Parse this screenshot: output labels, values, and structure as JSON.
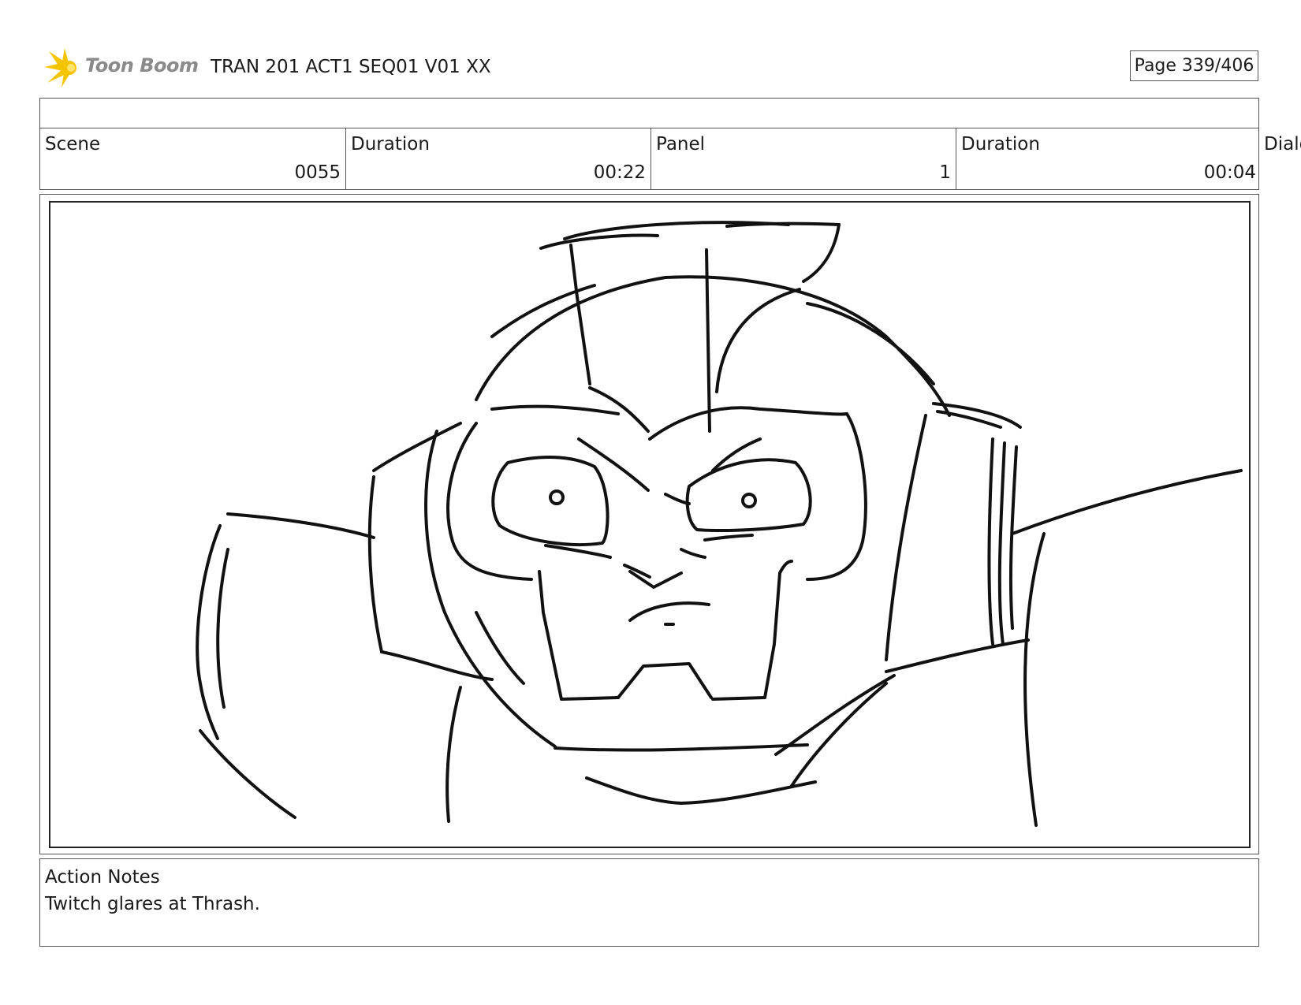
{
  "header": {
    "logo_text": "Toon Boom",
    "project_title": "TRAN 201 ACT1 SEQ01 V01 XX",
    "page_indicator": "Page 339/406"
  },
  "info": {
    "scene_label": "Scene",
    "scene_value": "0055",
    "scene_duration_label": "Duration",
    "scene_duration_value": "00:22",
    "panel_label": "Panel",
    "panel_value": "1",
    "panel_duration_label": "Duration",
    "panel_duration_value": "00:04",
    "dialog_label": "Dialo"
  },
  "notes": {
    "label": "Action Notes",
    "text": "Twitch glares at Thrash."
  },
  "colors": {
    "logo_accent": "#f5c400",
    "logo_text": "#8a8a8a",
    "border": "#555555",
    "sketch_ink": "#111111"
  },
  "icons": {
    "logo": "toon-boom-starburst-icon"
  }
}
